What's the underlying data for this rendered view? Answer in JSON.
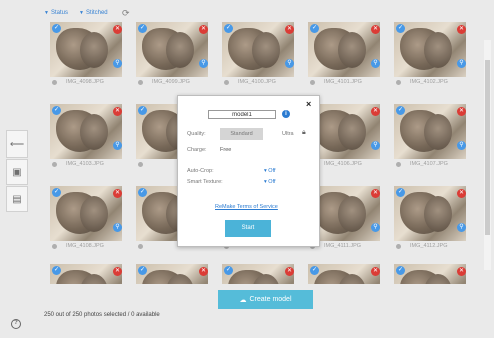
{
  "filters": {
    "status_label": "Status",
    "stitched_label": "Stitched",
    "refresh_icon": "refresh-icon"
  },
  "grid": {
    "rows": [
      [
        "IMG_4098.JPG",
        "IMG_4099.JPG",
        "IMG_4100.JPG",
        "IMG_4101.JPG",
        "IMG_4102.JPG"
      ],
      [
        "IMG_4103.JPG",
        "",
        "",
        "IMG_4106.JPG",
        "IMG_4107.JPG"
      ],
      [
        "IMG_4108.JPG",
        "",
        "",
        "IMG_4111.JPG",
        "IMG_4112.JPG"
      ],
      [
        "",
        "",
        "",
        "",
        ""
      ]
    ]
  },
  "sidebar": {
    "back_icon": "arrow-left-icon",
    "photos_icon_1": "photo-stack-icon",
    "photos_icon_2": "photo-stack-add-icon"
  },
  "modal": {
    "model_name": "model1",
    "info_glyph": "i",
    "close_glyph": "×",
    "quality_label": "Quality:",
    "quality_standard": "Standard",
    "quality_ultra": "Ultra",
    "charge_label": "Charge:",
    "charge_value": "Free",
    "autocrop_label": "Auto-Crop:",
    "autocrop_value": "Off",
    "smart_texture_label": "Smart Texture:",
    "smart_texture_value": "Off",
    "terms_link": "ReMake Terms of Service",
    "start_button": "Start"
  },
  "footer": {
    "create_button": "Create model",
    "status_text": "250 out of 250 photos selected / 0 available"
  },
  "colors": {
    "accent": "#2b7bd1",
    "button": "#55bcd9",
    "remove": "#d9302a"
  }
}
